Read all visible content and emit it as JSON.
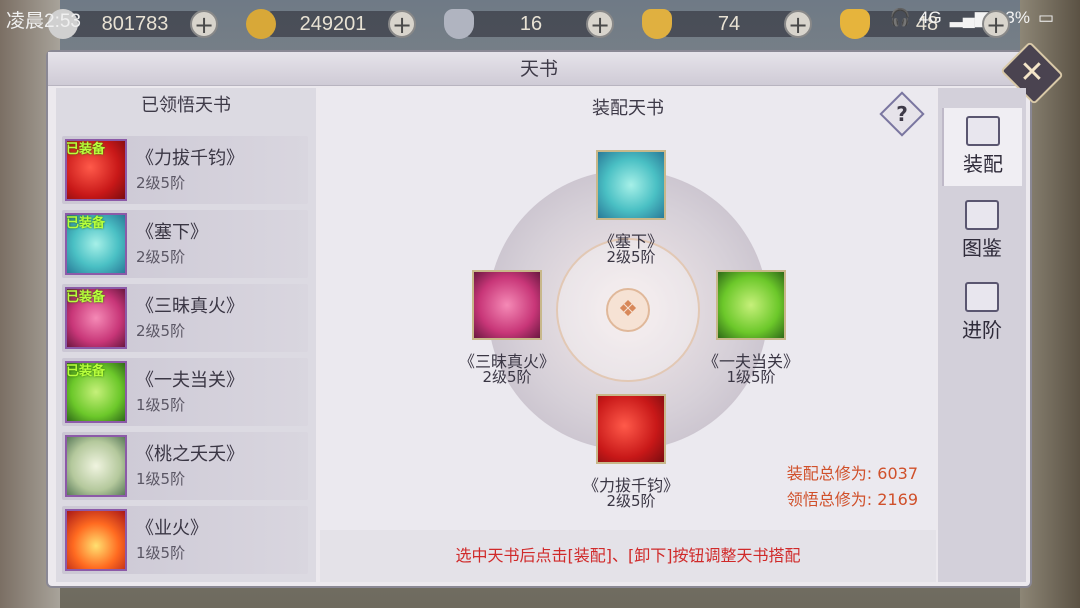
{
  "status_bar": {
    "time": "凌晨2:53",
    "signal": "4G",
    "battery": "33%"
  },
  "resources": [
    {
      "icon": "silver-coin-icon",
      "value": "801783",
      "color": "#d0d0d0"
    },
    {
      "icon": "gold-coin-icon",
      "value": "249201",
      "color": "#d8a838"
    },
    {
      "icon": "silver-ingot-icon",
      "value": "16",
      "color": "#b0b4c0"
    },
    {
      "icon": "gold-ingot-lock-icon",
      "value": "74",
      "color": "#e0b040"
    },
    {
      "icon": "gold-ingot-icon",
      "value": "48",
      "color": "#e6b43c"
    }
  ],
  "panel": {
    "title": "天书"
  },
  "left": {
    "title": "已领悟天书",
    "items": [
      {
        "name": "《力拔千钧》",
        "level": "2级5阶",
        "equipped": "已装备",
        "art": "art-red"
      },
      {
        "name": "《塞下》",
        "level": "2级5阶",
        "equipped": "已装备",
        "art": "art-teal"
      },
      {
        "name": "《三昧真火》",
        "level": "2级5阶",
        "equipped": "已装备",
        "art": "art-pink"
      },
      {
        "name": "《一夫当关》",
        "level": "1级5阶",
        "equipped": "已装备",
        "art": "art-green"
      },
      {
        "name": "《桃之夭夭》",
        "level": "1级5阶",
        "equipped": "",
        "art": "art-scroll"
      },
      {
        "name": "《业火》",
        "level": "1级5阶",
        "equipped": "",
        "art": "art-fire"
      }
    ]
  },
  "center": {
    "title": "装配天书",
    "help": "?",
    "slots": {
      "top": {
        "name": "《塞下》",
        "level": "2级5阶"
      },
      "left": {
        "name": "《三昧真火》",
        "level": "2级5阶"
      },
      "right": {
        "name": "《一夫当关》",
        "level": "1级5阶"
      },
      "bottom": {
        "name": "《力拔千钧》",
        "level": "2级5阶"
      }
    },
    "stats": {
      "equip_label": "装配总修为:",
      "equip_value": "6037",
      "comprehend_label": "领悟总修为:",
      "comprehend_value": "2169"
    },
    "hint": "选中天书后点击[装配]、[卸下]按钮调整天书搭配"
  },
  "tabs": [
    {
      "label": "装配",
      "icon": "book-shield-icon",
      "active": true
    },
    {
      "label": "图鉴",
      "icon": "book-eye-icon",
      "active": false
    },
    {
      "label": "进阶",
      "icon": "book-wings-icon",
      "active": false
    }
  ]
}
